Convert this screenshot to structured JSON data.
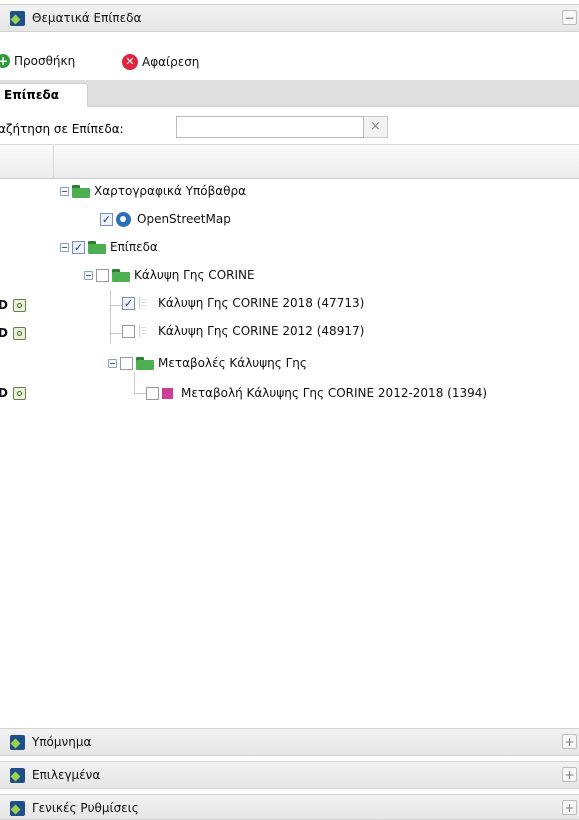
{
  "panels": {
    "top": {
      "title": "Θεματικά Επίπεδα",
      "tool": "−"
    },
    "legend": {
      "title": "Υπόμνημα",
      "tool": "+"
    },
    "selected": {
      "title": "Επιλεγμένα",
      "tool": "+"
    },
    "settings": {
      "title": "Γενικές Ρυθμίσεις",
      "tool": "+"
    }
  },
  "toolbar": {
    "add_label": "Προσθήκη",
    "remove_label": "Αφαίρεση"
  },
  "tabs": [
    {
      "label": "Επίπεδα",
      "active": true
    }
  ],
  "search": {
    "label": "αζήτηση σε Επίπεδα:",
    "value": "",
    "clear_glyph": "×"
  },
  "tree": {
    "basemaps": {
      "label": "Χαρτογραφικά Υπόβαθρα"
    },
    "osm": {
      "label": "OpenStreetMap",
      "checked": true
    },
    "layers": {
      "label": "Επίπεδα",
      "checked": true
    },
    "corine_group": {
      "label": "Κάλυψη Γης CORINE",
      "checked": false
    },
    "corine_2018": {
      "label": "Κάλυψη Γης CORINE 2018 (47713)",
      "checked": true
    },
    "corine_2012": {
      "label": "Κάλυψη Γης CORINE 2012 (48917)",
      "checked": false
    },
    "changes_group": {
      "label": "Μεταβολές Κάλυψης Γης",
      "checked": false
    },
    "change_2012_2018": {
      "label": "Μεταβολή Κάλυψης Γης CORINE 2012-2018 (1394)",
      "checked": false,
      "color": "#cc3f96"
    }
  },
  "row_tools": {
    "info_glyph": "D"
  }
}
